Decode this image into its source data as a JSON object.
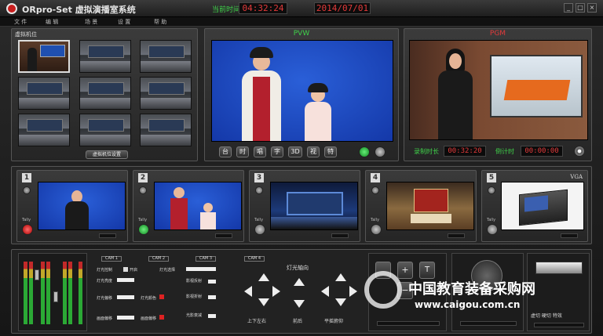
{
  "app": {
    "title": "ORpro-Set 虚拟演播室系统"
  },
  "clock": {
    "label": "当前时间",
    "time": "04:32:24",
    "date": "2014/07/01"
  },
  "window_controls": [
    "_",
    "□",
    "×"
  ],
  "menu": [
    "文 件",
    "编 辑",
    "场 景",
    "设 置",
    "帮 助"
  ],
  "camera_bank": {
    "title": "虚拟机位",
    "setting_button": "虚拟机位设置"
  },
  "pvw": {
    "title": "PVW",
    "buttons": [
      "台",
      "时",
      "唱",
      "字",
      "3D",
      "视",
      "特"
    ]
  },
  "pgm": {
    "title": "PGM",
    "record_label": "录制时长",
    "record_time": "00:32:20",
    "countdown_label": "倒计时",
    "countdown_time": "00:00:00"
  },
  "sources": [
    {
      "num": "1",
      "tally": "Tally"
    },
    {
      "num": "2",
      "tally": "Tally"
    },
    {
      "num": "3",
      "tally": "Tally"
    },
    {
      "num": "4",
      "tally": "Tally"
    },
    {
      "num": "5",
      "tally": "Tally",
      "badge": "VGA"
    }
  ],
  "control": {
    "cams": [
      "CAM 1",
      "CAM 2",
      "CAM 3",
      "CAM 4"
    ],
    "row1": {
      "light_ctrl": "灯光控制",
      "on": "开启",
      "light_select": "灯光选择"
    },
    "left_labels": [
      "灯光亮度",
      "灯光偏移",
      "灯光颜色",
      "画面偏移"
    ],
    "mid_labels": [
      "灯光颜色",
      "画面偏移"
    ],
    "right_labels": [
      "影视反射",
      "影视折射",
      "影视反射",
      "光影衰减"
    ],
    "light_axis": "灯光轴向",
    "dir_labels": [
      "上下左右",
      "前后",
      "平摇俯仰"
    ],
    "t_button": "T",
    "switch_label": "虚切 硬切 特效"
  },
  "watermark": {
    "name": "中国教育装备采购网",
    "url": "www.caigou.com.cn"
  }
}
